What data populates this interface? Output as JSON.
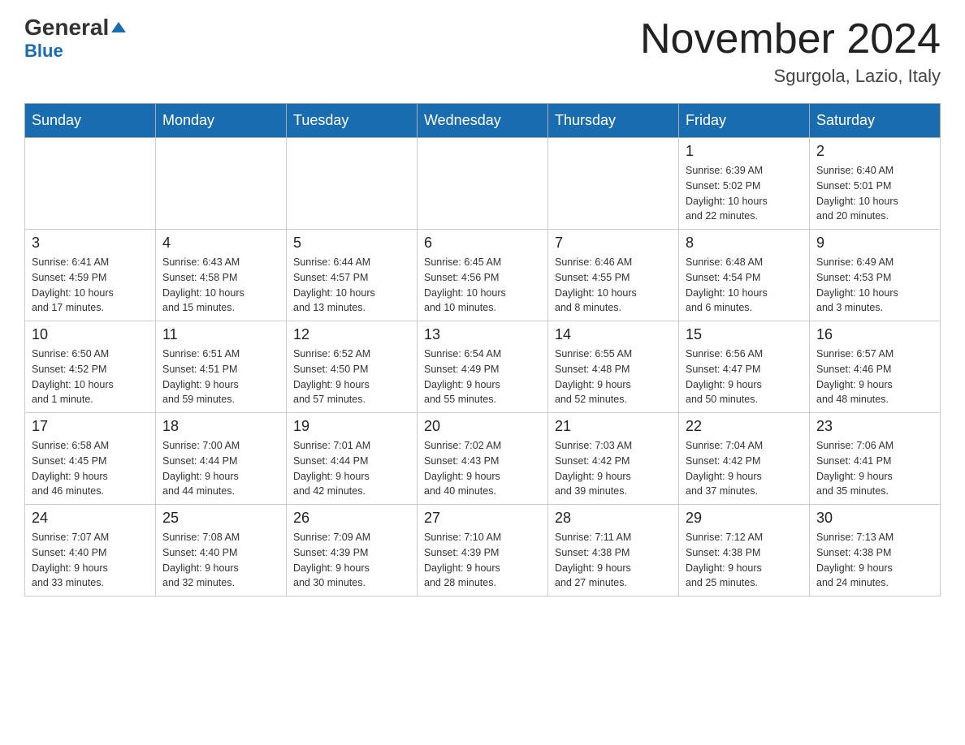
{
  "header": {
    "logo_general": "General",
    "logo_blue": "Blue",
    "month_title": "November 2024",
    "location": "Sgurgola, Lazio, Italy"
  },
  "weekdays": [
    "Sunday",
    "Monday",
    "Tuesday",
    "Wednesday",
    "Thursday",
    "Friday",
    "Saturday"
  ],
  "weeks": [
    [
      {
        "day": "",
        "info": ""
      },
      {
        "day": "",
        "info": ""
      },
      {
        "day": "",
        "info": ""
      },
      {
        "day": "",
        "info": ""
      },
      {
        "day": "",
        "info": ""
      },
      {
        "day": "1",
        "info": "Sunrise: 6:39 AM\nSunset: 5:02 PM\nDaylight: 10 hours\nand 22 minutes."
      },
      {
        "day": "2",
        "info": "Sunrise: 6:40 AM\nSunset: 5:01 PM\nDaylight: 10 hours\nand 20 minutes."
      }
    ],
    [
      {
        "day": "3",
        "info": "Sunrise: 6:41 AM\nSunset: 4:59 PM\nDaylight: 10 hours\nand 17 minutes."
      },
      {
        "day": "4",
        "info": "Sunrise: 6:43 AM\nSunset: 4:58 PM\nDaylight: 10 hours\nand 15 minutes."
      },
      {
        "day": "5",
        "info": "Sunrise: 6:44 AM\nSunset: 4:57 PM\nDaylight: 10 hours\nand 13 minutes."
      },
      {
        "day": "6",
        "info": "Sunrise: 6:45 AM\nSunset: 4:56 PM\nDaylight: 10 hours\nand 10 minutes."
      },
      {
        "day": "7",
        "info": "Sunrise: 6:46 AM\nSunset: 4:55 PM\nDaylight: 10 hours\nand 8 minutes."
      },
      {
        "day": "8",
        "info": "Sunrise: 6:48 AM\nSunset: 4:54 PM\nDaylight: 10 hours\nand 6 minutes."
      },
      {
        "day": "9",
        "info": "Sunrise: 6:49 AM\nSunset: 4:53 PM\nDaylight: 10 hours\nand 3 minutes."
      }
    ],
    [
      {
        "day": "10",
        "info": "Sunrise: 6:50 AM\nSunset: 4:52 PM\nDaylight: 10 hours\nand 1 minute."
      },
      {
        "day": "11",
        "info": "Sunrise: 6:51 AM\nSunset: 4:51 PM\nDaylight: 9 hours\nand 59 minutes."
      },
      {
        "day": "12",
        "info": "Sunrise: 6:52 AM\nSunset: 4:50 PM\nDaylight: 9 hours\nand 57 minutes."
      },
      {
        "day": "13",
        "info": "Sunrise: 6:54 AM\nSunset: 4:49 PM\nDaylight: 9 hours\nand 55 minutes."
      },
      {
        "day": "14",
        "info": "Sunrise: 6:55 AM\nSunset: 4:48 PM\nDaylight: 9 hours\nand 52 minutes."
      },
      {
        "day": "15",
        "info": "Sunrise: 6:56 AM\nSunset: 4:47 PM\nDaylight: 9 hours\nand 50 minutes."
      },
      {
        "day": "16",
        "info": "Sunrise: 6:57 AM\nSunset: 4:46 PM\nDaylight: 9 hours\nand 48 minutes."
      }
    ],
    [
      {
        "day": "17",
        "info": "Sunrise: 6:58 AM\nSunset: 4:45 PM\nDaylight: 9 hours\nand 46 minutes."
      },
      {
        "day": "18",
        "info": "Sunrise: 7:00 AM\nSunset: 4:44 PM\nDaylight: 9 hours\nand 44 minutes."
      },
      {
        "day": "19",
        "info": "Sunrise: 7:01 AM\nSunset: 4:44 PM\nDaylight: 9 hours\nand 42 minutes."
      },
      {
        "day": "20",
        "info": "Sunrise: 7:02 AM\nSunset: 4:43 PM\nDaylight: 9 hours\nand 40 minutes."
      },
      {
        "day": "21",
        "info": "Sunrise: 7:03 AM\nSunset: 4:42 PM\nDaylight: 9 hours\nand 39 minutes."
      },
      {
        "day": "22",
        "info": "Sunrise: 7:04 AM\nSunset: 4:42 PM\nDaylight: 9 hours\nand 37 minutes."
      },
      {
        "day": "23",
        "info": "Sunrise: 7:06 AM\nSunset: 4:41 PM\nDaylight: 9 hours\nand 35 minutes."
      }
    ],
    [
      {
        "day": "24",
        "info": "Sunrise: 7:07 AM\nSunset: 4:40 PM\nDaylight: 9 hours\nand 33 minutes."
      },
      {
        "day": "25",
        "info": "Sunrise: 7:08 AM\nSunset: 4:40 PM\nDaylight: 9 hours\nand 32 minutes."
      },
      {
        "day": "26",
        "info": "Sunrise: 7:09 AM\nSunset: 4:39 PM\nDaylight: 9 hours\nand 30 minutes."
      },
      {
        "day": "27",
        "info": "Sunrise: 7:10 AM\nSunset: 4:39 PM\nDaylight: 9 hours\nand 28 minutes."
      },
      {
        "day": "28",
        "info": "Sunrise: 7:11 AM\nSunset: 4:38 PM\nDaylight: 9 hours\nand 27 minutes."
      },
      {
        "day": "29",
        "info": "Sunrise: 7:12 AM\nSunset: 4:38 PM\nDaylight: 9 hours\nand 25 minutes."
      },
      {
        "day": "30",
        "info": "Sunrise: 7:13 AM\nSunset: 4:38 PM\nDaylight: 9 hours\nand 24 minutes."
      }
    ]
  ]
}
